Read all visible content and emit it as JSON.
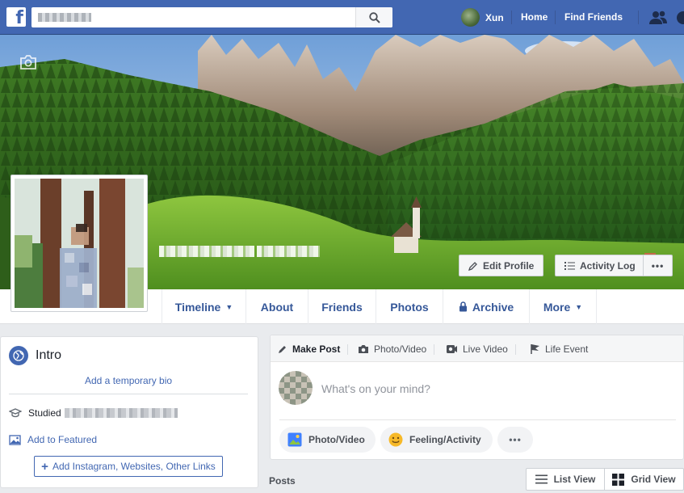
{
  "topbar": {
    "logo": "f",
    "search_icon": "search-icon",
    "user_name": "Xun",
    "home_label": "Home",
    "find_friends_label": "Find Friends",
    "brand_color": "#4267b2"
  },
  "cover": {
    "camera_icon": "camera-icon",
    "edit_profile_label": "Edit Profile",
    "activity_log_label": "Activity Log",
    "more_label": "•••"
  },
  "tabs": {
    "timeline": "Timeline",
    "about": "About",
    "friends": "Friends",
    "photos": "Photos",
    "archive": "Archive",
    "more": "More"
  },
  "intro": {
    "title": "Intro",
    "add_bio_label": "Add a temporary bio",
    "studied_label": "Studied",
    "add_featured_label": "Add to Featured",
    "add_links_label": "Add Instagram, Websites, Other Links"
  },
  "composer": {
    "make_post_label": "Make Post",
    "photo_video_tab_label": "Photo/Video",
    "live_video_label": "Live Video",
    "life_event_label": "Life Event",
    "placeholder": "What's on your mind?",
    "photo_video_pill_label": "Photo/Video",
    "feeling_activity_label": "Feeling/Activity",
    "more_pill_label": "•••"
  },
  "posts": {
    "label": "Posts",
    "list_view_label": "List View",
    "grid_view_label": "Grid View"
  }
}
